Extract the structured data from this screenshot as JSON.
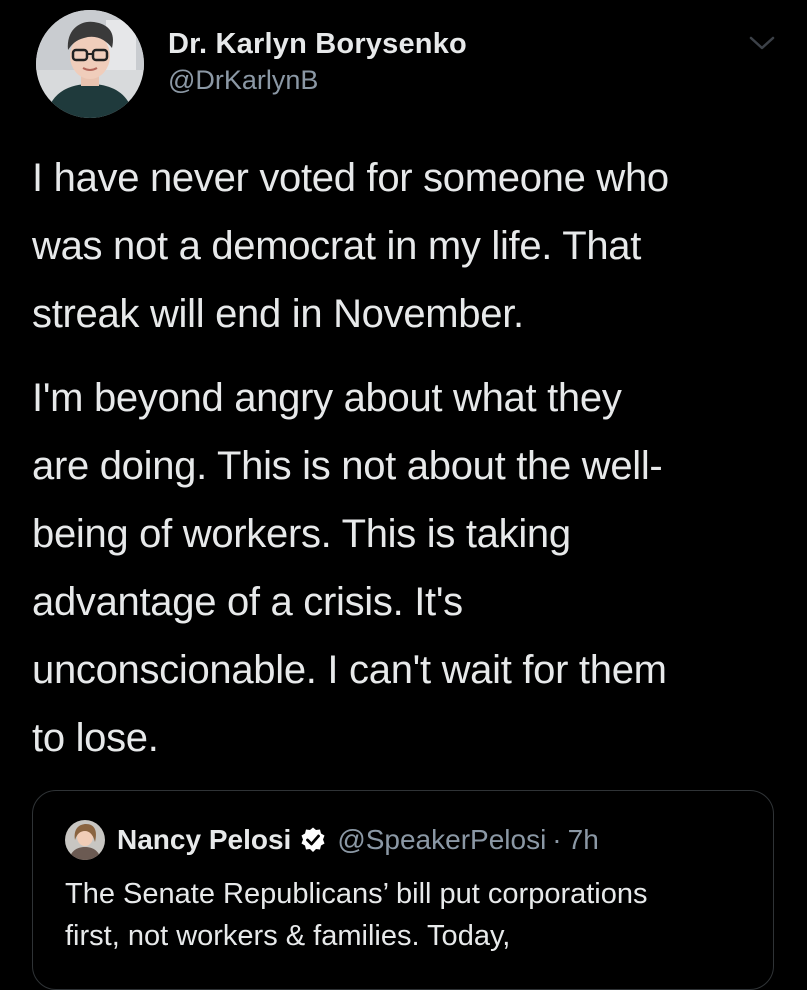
{
  "tweet": {
    "author": {
      "display_name": "Dr. Karlyn Borysenko",
      "handle": "@DrKarlynB",
      "avatar_icon": "profile-photo-icon"
    },
    "menu_icon": "chevron-down-icon",
    "paragraphs": [
      "I have never voted for someone who\nwas not a democrat in my life. That\nstreak will end in November.",
      "I'm beyond angry about what they\nare doing. This is not about the well-\nbeing of workers. This is taking\nadvantage of a crisis. It's\nunconscionable. I can't wait for them\nto lose."
    ]
  },
  "quoted_tweet": {
    "author": {
      "display_name": "Nancy Pelosi",
      "handle": "@SpeakerPelosi",
      "verified": true,
      "avatar_icon": "profile-photo-icon"
    },
    "separator": "·",
    "time": "7h",
    "text": "The Senate Republicans’ bill put corporations\nfirst, not workers & families. Today,"
  },
  "colors": {
    "background": "#000000",
    "primary_text": "#e7e9ea",
    "secondary_text": "#8b98a5",
    "border": "#2f3336",
    "verified_badge": "#ffffff"
  }
}
